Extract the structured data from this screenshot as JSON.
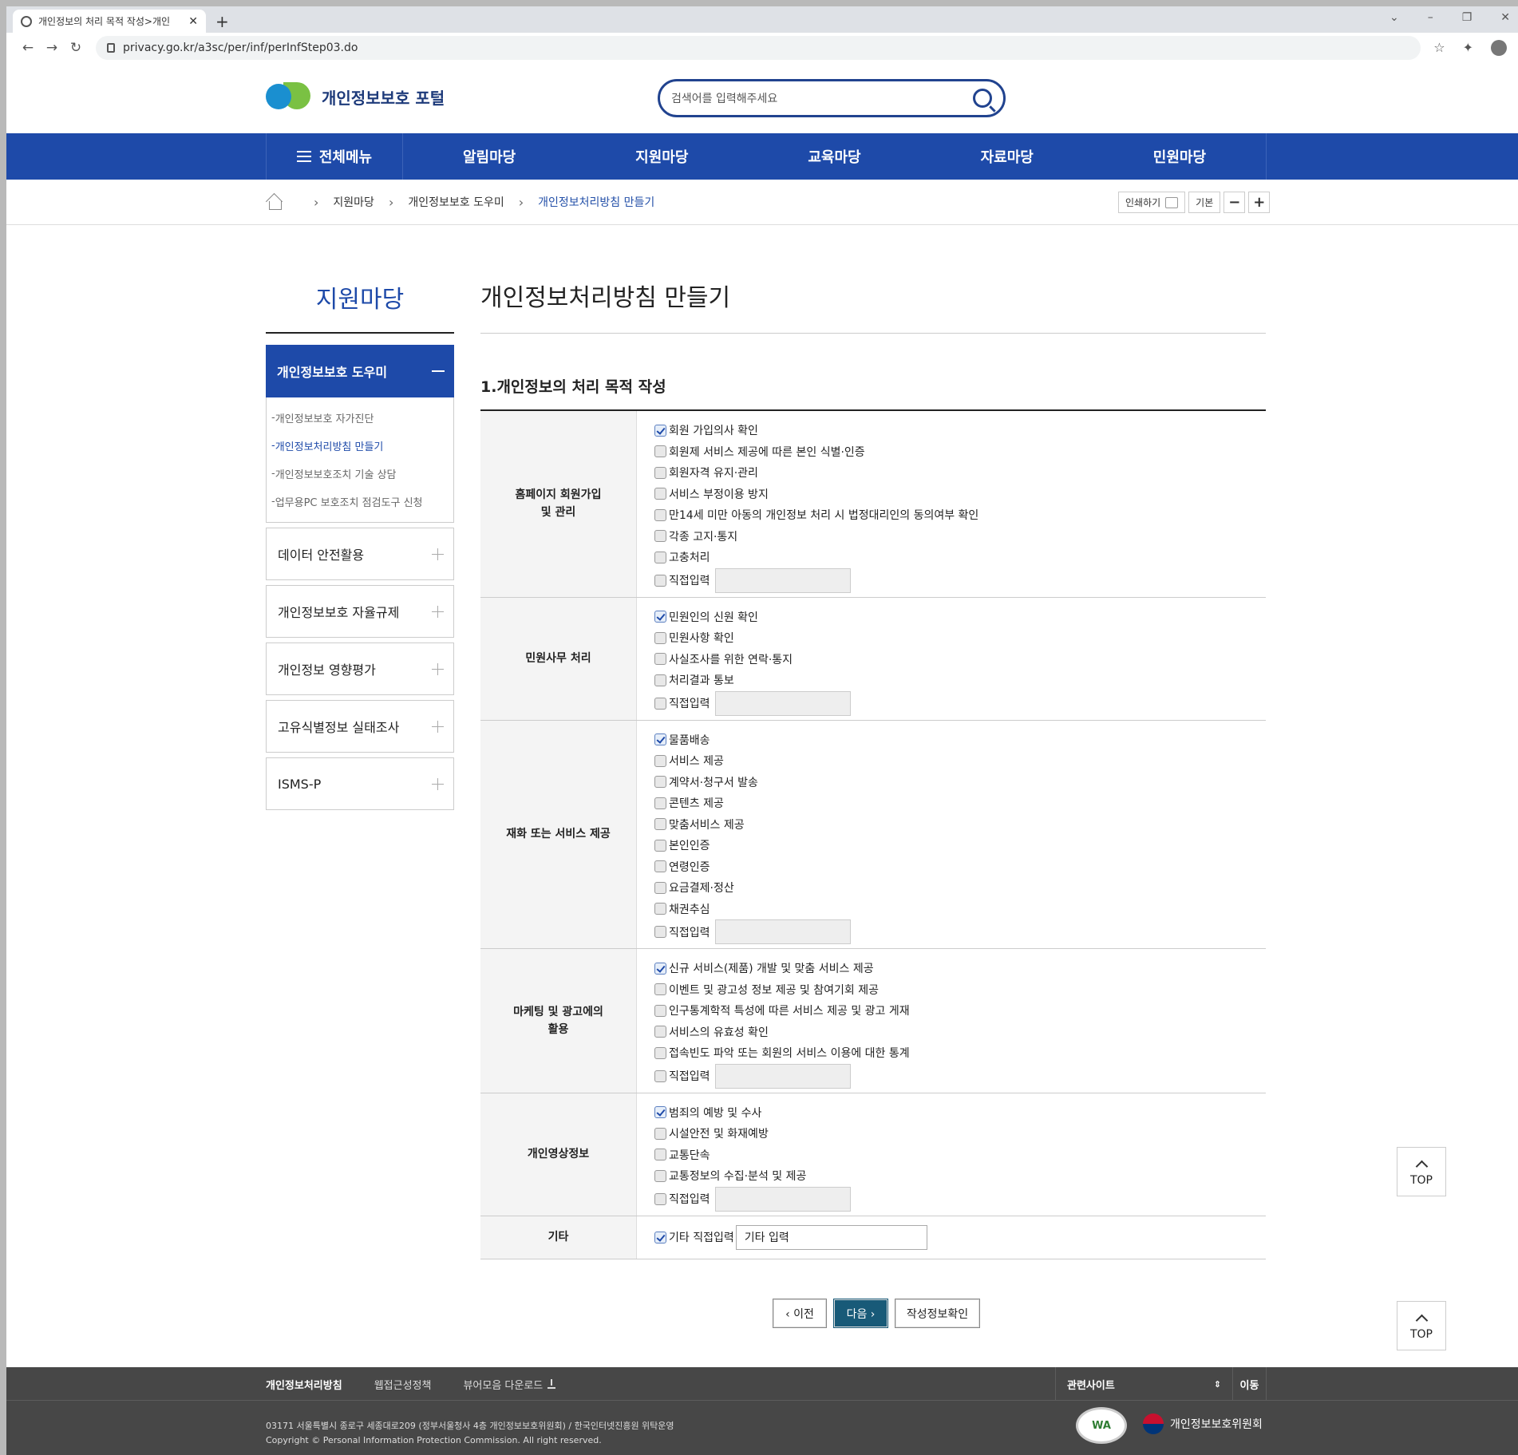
{
  "browser": {
    "tab_title": "개인정보의 처리 목적 작성>개인",
    "url": "privacy.go.kr/a3sc/per/inf/perInfStep03.do"
  },
  "header": {
    "logo_text": "개인정보보호 포털",
    "search_placeholder": "검색어를 입력해주세요"
  },
  "gnb": {
    "all_menu": "전체메뉴",
    "items": [
      "알림마당",
      "지원마당",
      "교육마당",
      "자료마당",
      "민원마당"
    ]
  },
  "breadcrumb": {
    "items": [
      "지원마당",
      "개인정보보호 도우미",
      "개인정보처리방침 만들기"
    ],
    "print_label": "인쇄하기",
    "font_default": "기본",
    "font_minus": "−",
    "font_plus": "+"
  },
  "lnb": {
    "title": "지원마당",
    "open_section": "개인정보보호 도우미",
    "sub_items": [
      "개인정보보호 자가진단",
      "개인정보처리방침 만들기",
      "개인정보보호조치 기술 상담",
      "업무용PC 보호조치 점검도구 신청"
    ],
    "sections": [
      "데이터 안전활용",
      "개인정보보호 자율규제",
      "개인정보 영향평가",
      "고유식별정보 실태조사",
      "ISMS-P"
    ]
  },
  "main": {
    "page_title": "개인정보처리방침 만들기",
    "section_title": "1.개인정보의 처리 목적 작성",
    "direct_label": "직접입력",
    "groups": [
      {
        "label": "홈페이지 회원가입 및 관리",
        "options": [
          "회원 가입의사 확인",
          "회원제 서비스 제공에 따른 본인 식별·인증",
          "회원자격 유지·관리",
          "서비스 부정이용 방지",
          "만14세 미만 아동의 개인정보 처리 시 법정대리인의 동의여부 확인",
          "각종 고지·통지",
          "고충처리"
        ]
      },
      {
        "label": "민원사무 처리",
        "options": [
          "민원인의 신원 확인",
          "민원사항 확인",
          "사실조사를 위한 연락·통지",
          "처리결과 통보"
        ]
      },
      {
        "label": "재화 또는 서비스 제공",
        "options": [
          "물품배송",
          "서비스 제공",
          "계약서·청구서 발송",
          "콘텐츠 제공",
          "맞춤서비스 제공",
          "본인인증",
          "연령인증",
          "요금결제·정산",
          "채권추심"
        ]
      },
      {
        "label": "마케팅 및 광고에의 활용",
        "options": [
          "신규 서비스(제품) 개발 및 맞춤 서비스 제공",
          "이벤트 및 광고성 정보 제공 및 참여기회 제공",
          "인구통계학적 특성에 따른 서비스 제공 및 광고 게재",
          "서비스의 유효성 확인",
          "접속빈도 파악 또는 회원의 서비스 이용에 대한 통계"
        ]
      },
      {
        "label": "개인영상정보",
        "options": [
          "범죄의 예방 및 수사",
          "시설안전 및 화재예방",
          "교통단속",
          "교통정보의 수집·분석 및 제공"
        ]
      }
    ],
    "etc": {
      "label": "기타",
      "option": "기타 직접입력",
      "input_value": "기타 입력"
    },
    "buttons": {
      "prev": "‹ 이전",
      "next": "다음 ›",
      "confirm": "작성정보확인"
    }
  },
  "top_button": "TOP",
  "footer": {
    "links": [
      "개인정보처리방침",
      "웹접근성정책",
      "뷰어모음 다운로드"
    ],
    "related": "관련사이트",
    "go": "이동",
    "address": "03171 서울특별시 종로구 세종대로209 (정부서울청사 4층 개인정보보호위원회) / 한국인터넷진흥원 위탁운영",
    "copyright": "Copyright © Personal Information Protection Commission. All right reserved.",
    "wa_mark": "WA",
    "org": "개인정보보호위원회"
  }
}
